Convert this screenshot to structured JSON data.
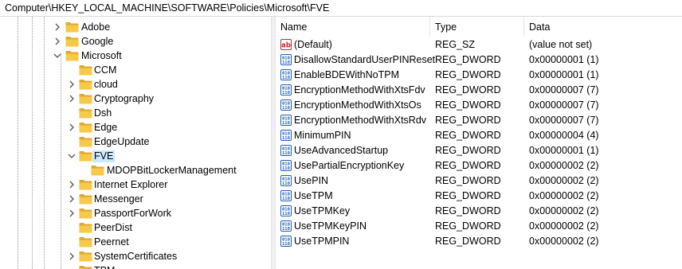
{
  "address_bar": {
    "path": "Computer\\HKEY_LOCAL_MACHINE\\SOFTWARE\\Policies\\Microsoft\\FVE"
  },
  "tree": {
    "items": [
      {
        "label": "Adobe",
        "chevron": "right",
        "depth": 0
      },
      {
        "label": "Google",
        "chevron": "right",
        "depth": 0
      },
      {
        "label": "Microsoft",
        "chevron": "down",
        "depth": 0
      },
      {
        "label": "CCM",
        "chevron": "none",
        "depth": 1
      },
      {
        "label": "cloud",
        "chevron": "right",
        "depth": 1
      },
      {
        "label": "Cryptography",
        "chevron": "right",
        "depth": 1
      },
      {
        "label": "Dsh",
        "chevron": "none",
        "depth": 1
      },
      {
        "label": "Edge",
        "chevron": "right",
        "depth": 1
      },
      {
        "label": "EdgeUpdate",
        "chevron": "none",
        "depth": 1
      },
      {
        "label": "FVE",
        "chevron": "down",
        "depth": 1,
        "selected": true
      },
      {
        "label": "MDOPBitLockerManagement",
        "chevron": "none",
        "depth": 2
      },
      {
        "label": "Internet Explorer",
        "chevron": "right",
        "depth": 1
      },
      {
        "label": "Messenger",
        "chevron": "right",
        "depth": 1
      },
      {
        "label": "PassportForWork",
        "chevron": "right",
        "depth": 1
      },
      {
        "label": "PeerDist",
        "chevron": "none",
        "depth": 1
      },
      {
        "label": "Peernet",
        "chevron": "none",
        "depth": 1
      },
      {
        "label": "SystemCertificates",
        "chevron": "right",
        "depth": 1
      },
      {
        "label": "TPM",
        "chevron": "none",
        "depth": 1
      }
    ]
  },
  "values_list": {
    "headers": {
      "name": "Name",
      "type": "Type",
      "data": "Data"
    },
    "rows": [
      {
        "icon": "string-value-icon",
        "name": "(Default)",
        "type": "REG_SZ",
        "data": "(value not set)"
      },
      {
        "icon": "binary-value-icon",
        "name": "DisallowStandardUserPINReset",
        "type": "REG_DWORD",
        "data": "0x00000001 (1)"
      },
      {
        "icon": "binary-value-icon",
        "name": "EnableBDEWithNoTPM",
        "type": "REG_DWORD",
        "data": "0x00000001 (1)"
      },
      {
        "icon": "binary-value-icon",
        "name": "EncryptionMethodWithXtsFdv",
        "type": "REG_DWORD",
        "data": "0x00000007 (7)"
      },
      {
        "icon": "binary-value-icon",
        "name": "EncryptionMethodWithXtsOs",
        "type": "REG_DWORD",
        "data": "0x00000007 (7)"
      },
      {
        "icon": "binary-value-icon",
        "name": "EncryptionMethodWithXtsRdv",
        "type": "REG_DWORD",
        "data": "0x00000007 (7)"
      },
      {
        "icon": "binary-value-icon",
        "name": "MinimumPIN",
        "type": "REG_DWORD",
        "data": "0x00000004 (4)"
      },
      {
        "icon": "binary-value-icon",
        "name": "UseAdvancedStartup",
        "type": "REG_DWORD",
        "data": "0x00000001 (1)"
      },
      {
        "icon": "binary-value-icon",
        "name": "UsePartialEncryptionKey",
        "type": "REG_DWORD",
        "data": "0x00000002 (2)"
      },
      {
        "icon": "binary-value-icon",
        "name": "UsePIN",
        "type": "REG_DWORD",
        "data": "0x00000002 (2)"
      },
      {
        "icon": "binary-value-icon",
        "name": "UseTPM",
        "type": "REG_DWORD",
        "data": "0x00000002 (2)"
      },
      {
        "icon": "binary-value-icon",
        "name": "UseTPMKey",
        "type": "REG_DWORD",
        "data": "0x00000002 (2)"
      },
      {
        "icon": "binary-value-icon",
        "name": "UseTPMKeyPIN",
        "type": "REG_DWORD",
        "data": "0x00000002 (2)"
      },
      {
        "icon": "binary-value-icon",
        "name": "UseTPMPIN",
        "type": "REG_DWORD",
        "data": "0x00000002 (2)"
      }
    ]
  },
  "colors": {
    "selection": "#cce8ff",
    "folder": "#f7c948",
    "folder_dark": "#e0a82e",
    "value_icon_blue": "#1f5fb4",
    "string_icon_red": "#c4262e"
  }
}
